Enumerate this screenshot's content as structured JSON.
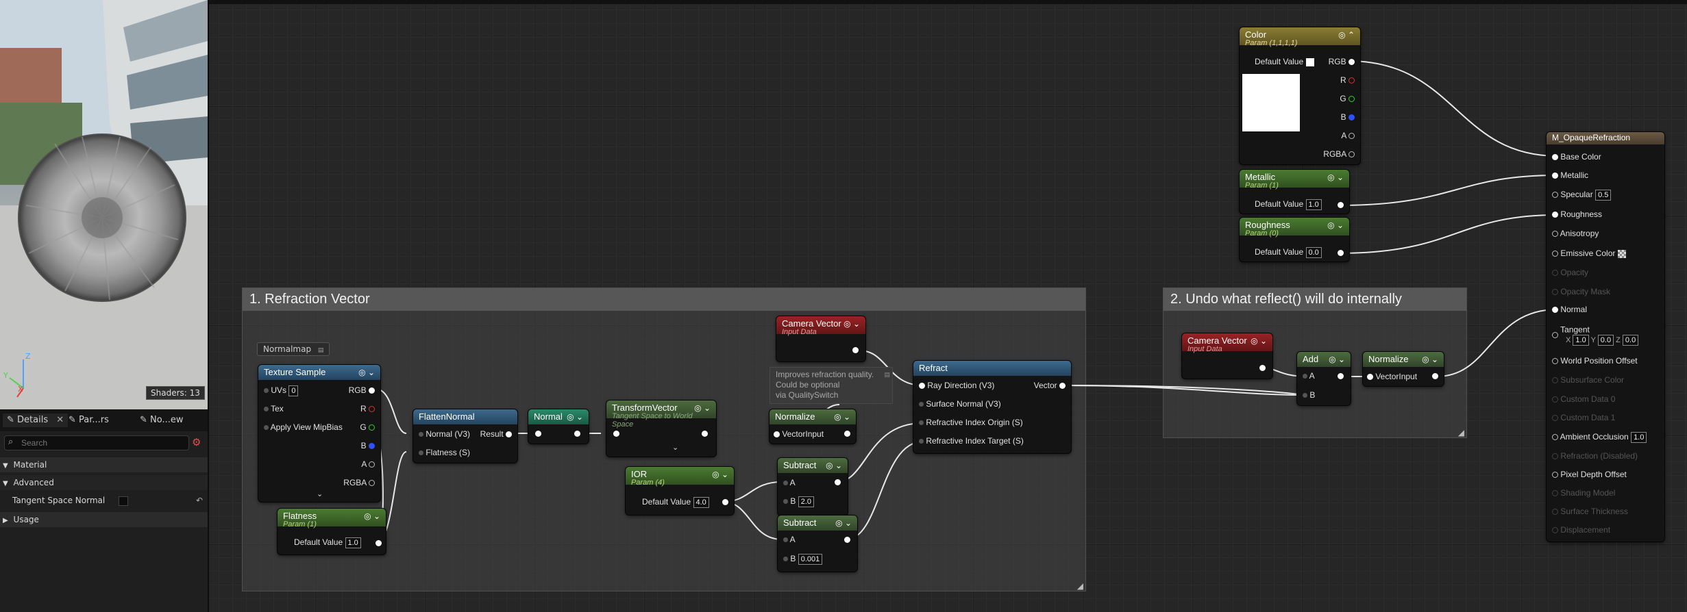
{
  "preview": {
    "shaders_label": "Shaders: 13",
    "axis_z": "Z",
    "axis_y": "Y",
    "axis_x": "X"
  },
  "panel": {
    "tabs": [
      {
        "label": "Details"
      },
      {
        "label": "Par...rs"
      },
      {
        "label": "No...ew"
      }
    ],
    "search_placeholder": "Search",
    "sections": {
      "material": "Material",
      "advanced": "Advanced",
      "tangent_space_normal": "Tangent Space Normal",
      "usage": "Usage"
    }
  },
  "comments": [
    {
      "title": "1. Refraction Vector"
    },
    {
      "title": "2. Undo what reflect() will do internally"
    }
  ],
  "nodes": {
    "normalmap_label": "Normalmap",
    "texture_sample": {
      "title": "Texture Sample",
      "inputs": [
        "UVs",
        "Tex",
        "Apply View MipBias"
      ],
      "uvs_value": "0",
      "outputs": [
        "RGB",
        "R",
        "G",
        "B",
        "A",
        "RGBA"
      ]
    },
    "flatness": {
      "title": "Flatness",
      "subtitle": "Param (1)",
      "default_label": "Default Value",
      "default_value": "1.0"
    },
    "flatten_normal": {
      "title": "FlattenNormal",
      "in1": "Normal (V3)",
      "out": "Result",
      "in2": "Flatness (S)"
    },
    "normal": {
      "title": "Normal"
    },
    "transform_vector": {
      "title": "TransformVector",
      "subtitle": "Tangent Space to World Space"
    },
    "normalize1": {
      "title": "Normalize",
      "input": "VectorInput"
    },
    "camera_vector1": {
      "title": "Camera Vector",
      "subtitle": "Input Data"
    },
    "note": {
      "lines": [
        "Improves refraction quality.",
        "Could be optional",
        "via QualitySwitch"
      ]
    },
    "ior": {
      "title": "IOR",
      "subtitle": "Param (4)",
      "default_label": "Default Value",
      "default_value": "4.0"
    },
    "subtract1": {
      "title": "Subtract",
      "a": "A",
      "b": "B",
      "b_value": "2.0"
    },
    "subtract2": {
      "title": "Subtract",
      "a": "A",
      "b": "B",
      "b_value": "0.001"
    },
    "refract": {
      "title": "Refract",
      "out": "Vector",
      "inputs": [
        "Ray Direction (V3)",
        "Surface Normal (V3)",
        "Refractive Index Origin (S)",
        "Refractive Index Target (S)"
      ]
    },
    "camera_vector2": {
      "title": "Camera Vector",
      "subtitle": "Input Data"
    },
    "add": {
      "title": "Add",
      "a": "A",
      "b": "B"
    },
    "normalize2": {
      "title": "Normalize",
      "input": "VectorInput"
    },
    "color": {
      "title": "Color",
      "subtitle": "Param (1,1,1,1)",
      "default_label": "Default Value",
      "outputs": [
        "RGB",
        "R",
        "G",
        "B",
        "A",
        "RGBA"
      ]
    },
    "metallic": {
      "title": "Metallic",
      "subtitle": "Param (1)",
      "default_label": "Default Value",
      "default_value": "1.0"
    },
    "roughness": {
      "title": "Roughness",
      "subtitle": "Param (0)",
      "default_label": "Default Value",
      "default_value": "0.0"
    },
    "material": {
      "title": "M_OpaqueRefraction",
      "specular_value": "0.5",
      "ambient_value": "1.0",
      "tangent": {
        "label": "Tangent",
        "x": "X",
        "xv": "1.0",
        "y": "Y",
        "yv": "0.0",
        "z": "Z",
        "zv": "0.0"
      },
      "pins": [
        "Base Color",
        "Metallic",
        "Specular",
        "Roughness",
        "Anisotropy",
        "Emissive Color",
        "Opacity",
        "Opacity Mask",
        "Normal",
        "Tangent",
        "World Position Offset",
        "Subsurface Color",
        "Custom Data 0",
        "Custom Data 1",
        "Ambient Occlusion",
        "Refraction (Disabled)",
        "Pixel Depth Offset",
        "Shading Model",
        "Surface Thickness",
        "Displacement"
      ]
    }
  },
  "colors": {
    "yellow_header": "#8b7e33",
    "green_header": "#4b7c31",
    "blue_header": "#3d6a8c",
    "teal_header": "#2b8a6b",
    "red_header": "#9a2225",
    "pin_r": "#e03030",
    "pin_g": "#30d030",
    "pin_b": "#3050ff"
  }
}
